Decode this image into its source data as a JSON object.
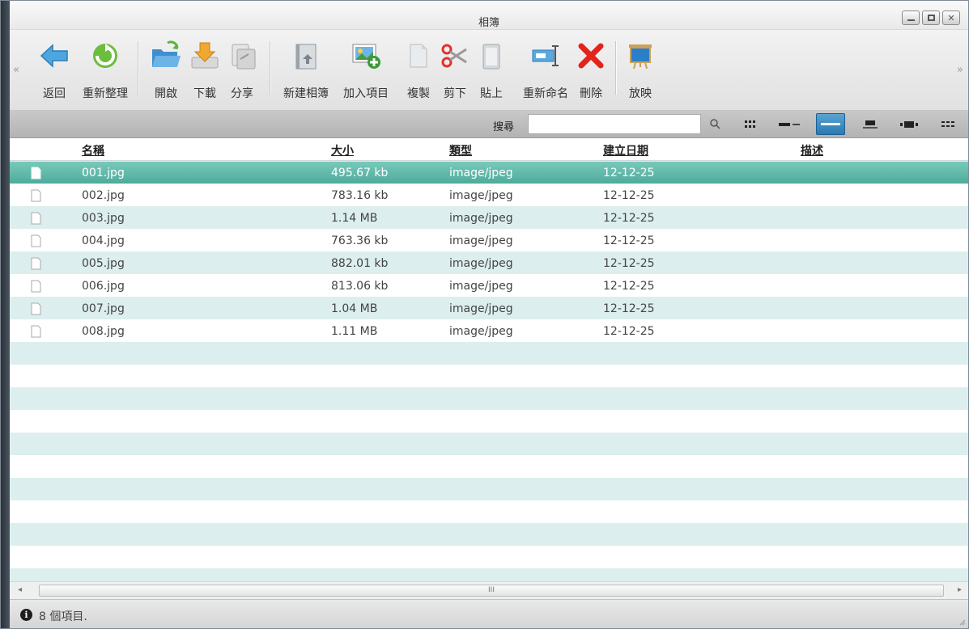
{
  "window": {
    "title": "相簿"
  },
  "window_controls": [
    "minimize",
    "maximize",
    "close"
  ],
  "toolbar": {
    "items": [
      {
        "label": "返回",
        "icon": "back-arrow-icon"
      },
      {
        "label": "重新整理",
        "icon": "refresh-icon"
      },
      {
        "label": "開啟",
        "icon": "open-folder-icon"
      },
      {
        "label": "下載",
        "icon": "download-icon"
      },
      {
        "label": "分享",
        "icon": "share-icon"
      },
      {
        "label": "新建相簿",
        "icon": "new-album-icon"
      },
      {
        "label": "加入項目",
        "icon": "add-item-icon"
      },
      {
        "label": "複製",
        "icon": "copy-icon"
      },
      {
        "label": "剪下",
        "icon": "cut-icon"
      },
      {
        "label": "貼上",
        "icon": "paste-icon"
      },
      {
        "label": "重新命名",
        "icon": "rename-icon"
      },
      {
        "label": "刪除",
        "icon": "delete-icon"
      },
      {
        "label": "放映",
        "icon": "slideshow-icon"
      }
    ],
    "scroll_left": "«",
    "scroll_right": "»"
  },
  "search": {
    "label": "搜尋",
    "value": "",
    "placeholder": ""
  },
  "view_modes": [
    {
      "name": "icon-grid-view",
      "active": false
    },
    {
      "name": "list-view",
      "active": false
    },
    {
      "name": "details-view",
      "active": true
    },
    {
      "name": "tiles-view",
      "active": false
    },
    {
      "name": "filmstrip-view",
      "active": false
    },
    {
      "name": "thumbnail-view",
      "active": false
    }
  ],
  "table": {
    "columns": [
      "名稱",
      "大小",
      "類型",
      "建立日期",
      "描述"
    ],
    "rows": [
      {
        "name": "001.jpg",
        "size": "495.67 kb",
        "type": "image/jpeg",
        "date": "12-12-25",
        "desc": "",
        "selected": true
      },
      {
        "name": "002.jpg",
        "size": "783.16 kb",
        "type": "image/jpeg",
        "date": "12-12-25",
        "desc": ""
      },
      {
        "name": "003.jpg",
        "size": "1.14 MB",
        "type": "image/jpeg",
        "date": "12-12-25",
        "desc": ""
      },
      {
        "name": "004.jpg",
        "size": "763.36 kb",
        "type": "image/jpeg",
        "date": "12-12-25",
        "desc": ""
      },
      {
        "name": "005.jpg",
        "size": "882.01 kb",
        "type": "image/jpeg",
        "date": "12-12-25",
        "desc": ""
      },
      {
        "name": "006.jpg",
        "size": "813.06 kb",
        "type": "image/jpeg",
        "date": "12-12-25",
        "desc": ""
      },
      {
        "name": "007.jpg",
        "size": "1.04 MB",
        "type": "image/jpeg",
        "date": "12-12-25",
        "desc": ""
      },
      {
        "name": "008.jpg",
        "size": "1.11 MB",
        "type": "image/jpeg",
        "date": "12-12-25",
        "desc": ""
      }
    ]
  },
  "scrollbar": {
    "left": "◂",
    "right": "▸",
    "grip": "III"
  },
  "status": {
    "text": "8 個項目."
  },
  "colors": {
    "selected_row": "#5bb5a6",
    "alt_row": "#dceeee",
    "active_view": "#2a79b3"
  }
}
